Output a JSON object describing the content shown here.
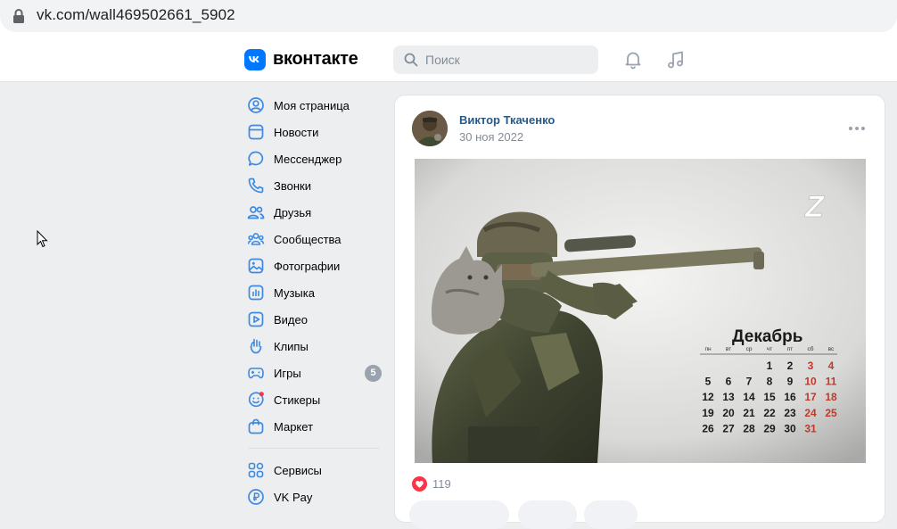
{
  "browser": {
    "url": "vk.com/wall469502661_5902"
  },
  "header": {
    "logo_letter": "VK",
    "logo_text": "вконтакте",
    "search_placeholder": "Поиск"
  },
  "nav": {
    "items": [
      {
        "label": "Моя страница",
        "icon": "user-circle-icon"
      },
      {
        "label": "Новости",
        "icon": "news-icon"
      },
      {
        "label": "Мессенджер",
        "icon": "chat-icon"
      },
      {
        "label": "Звонки",
        "icon": "phone-icon"
      },
      {
        "label": "Друзья",
        "icon": "friends-icon"
      },
      {
        "label": "Сообщества",
        "icon": "communities-icon"
      },
      {
        "label": "Фотографии",
        "icon": "photo-icon"
      },
      {
        "label": "Музыка",
        "icon": "music-icon"
      },
      {
        "label": "Видео",
        "icon": "video-icon"
      },
      {
        "label": "Клипы",
        "icon": "clips-icon"
      },
      {
        "label": "Игры",
        "icon": "gamepad-icon",
        "badge": "5"
      },
      {
        "label": "Стикеры",
        "icon": "sticker-icon"
      },
      {
        "label": "Маркет",
        "icon": "market-icon"
      }
    ],
    "secondary": [
      {
        "label": "Сервисы",
        "icon": "services-icon"
      },
      {
        "label": "VK Pay",
        "icon": "vkpay-icon"
      }
    ]
  },
  "post": {
    "author": "Виктор Ткаченко",
    "date": "30 ноя 2022",
    "likes": "119",
    "image": {
      "month": "Декабрь",
      "weekdays": [
        "пн",
        "вт",
        "ср",
        "чт",
        "пт",
        "сб",
        "вс"
      ],
      "weeks": [
        [
          "",
          "",
          "",
          "1",
          "2",
          "3",
          "4"
        ],
        [
          "5",
          "6",
          "7",
          "8",
          "9",
          "10",
          "11"
        ],
        [
          "12",
          "13",
          "14",
          "15",
          "16",
          "17",
          "18"
        ],
        [
          "19",
          "20",
          "21",
          "22",
          "23",
          "24",
          "25"
        ],
        [
          "26",
          "27",
          "28",
          "29",
          "30",
          "31",
          ""
        ]
      ],
      "logo_letter": "Z"
    }
  },
  "colors": {
    "accent": "#0077ff",
    "link": "#2a5885",
    "secondary_text": "#818c99",
    "weekend": "#c0392b",
    "like": "#ff3347"
  }
}
